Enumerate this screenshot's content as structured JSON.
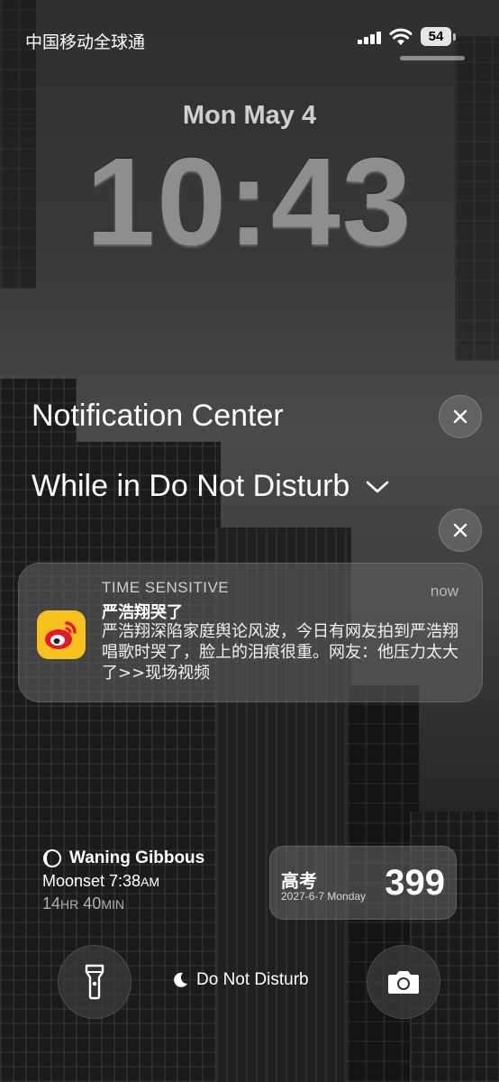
{
  "status_bar": {
    "carrier": "中国移动全球通",
    "battery_level": "54"
  },
  "lock": {
    "date": "Mon May 4",
    "time": "10:43"
  },
  "notification_center": {
    "title": "Notification Center",
    "focus_section_label": "While in Do Not Disturb"
  },
  "notification": {
    "app_icon": "weibo-icon",
    "label": "TIME SENSITIVE",
    "time": "now",
    "title": "严浩翔哭了",
    "body": "严浩翔深陷家庭舆论风波，今日有网友拍到严浩翔唱歌时哭了，脸上的泪痕很重。网友：他压力太大了>>现场视频"
  },
  "moon_widget": {
    "phase": "Waning Gibbous",
    "moonset_label": "Moonset 7:38",
    "moonset_ampm": "AM",
    "duration_hours": "14",
    "duration_hours_unit": "HR",
    "duration_mins": "40",
    "duration_mins_unit": "MIN"
  },
  "countdown_widget": {
    "title": "高考",
    "date": "2027-6-7 Monday",
    "days": "399"
  },
  "bottom_bar": {
    "focus_label": "Do Not Disturb",
    "left_icon": "flashlight-icon",
    "right_icon": "camera-icon"
  },
  "colors": {
    "weibo_yellow": "#f7c21e",
    "weibo_red": "#e6162d"
  }
}
